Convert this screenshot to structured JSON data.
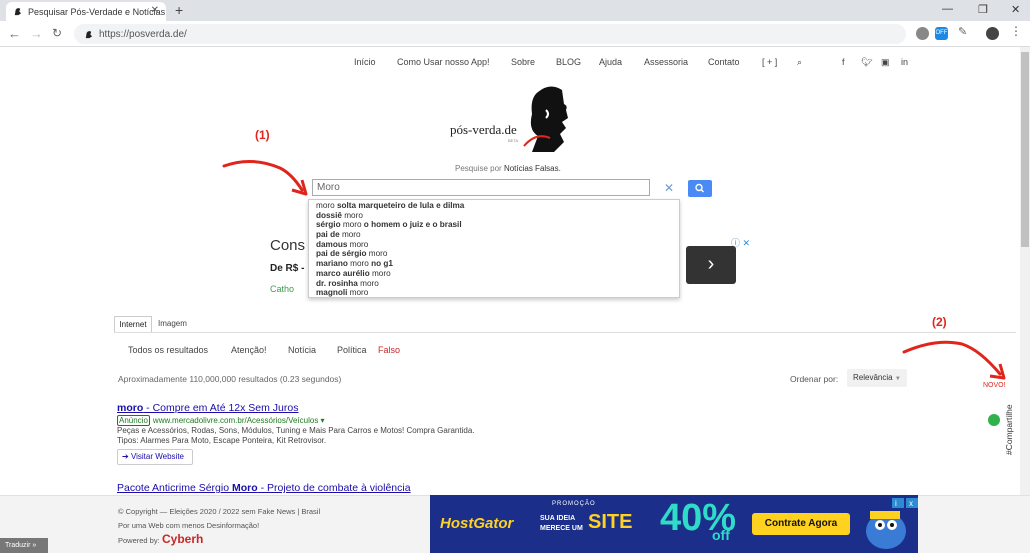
{
  "browser": {
    "tab_title": "Pesquisar Pós-Verdade e Notícias",
    "new_tab": "+",
    "window_min": "—",
    "window_restore": "❐",
    "window_close": "✕",
    "url": "https://posverda.de/",
    "ext_badge": "OFF"
  },
  "site_nav": {
    "items": [
      "Início",
      "Como Usar nosso App!",
      "Sobre",
      "BLOG",
      "Ajuda",
      "Assessoria",
      "Contato",
      "[ + ]"
    ],
    "social": [
      "f",
      "t",
      "ig",
      "in"
    ]
  },
  "logo": {
    "text": "pós-verda.de",
    "sub": "BETA"
  },
  "tagline": {
    "prefix": "Pesquise por",
    "bold": "Notícias Falsas."
  },
  "search": {
    "value": "Moro",
    "suggestions": [
      {
        "pre": "moro ",
        "bold": "solta marqueteiro de lula e dilma",
        "post": ""
      },
      {
        "pre": "",
        "bold": "dossiê ",
        "post": "moro"
      },
      {
        "pre": "",
        "bold": "sérgio ",
        "post": "moro ",
        "bold2": "o homem o juiz e o brasil"
      },
      {
        "pre": "",
        "bold": "pai de ",
        "post": "moro"
      },
      {
        "pre": "",
        "bold": "damous ",
        "post": "moro"
      },
      {
        "pre": "",
        "bold": "pai de sérgio ",
        "post": "moro"
      },
      {
        "pre": "",
        "bold": "mariano ",
        "post": "moro ",
        "bold2": "no g1"
      },
      {
        "pre": "",
        "bold": "marco aurélio ",
        "post": "moro"
      },
      {
        "pre": "",
        "bold": "dr. rosinha ",
        "post": "moro"
      },
      {
        "pre": "",
        "bold": "magnoli ",
        "post": "moro"
      }
    ]
  },
  "ad_behind": {
    "title": "Cons",
    "price": "De R$ -",
    "source": "Catho",
    "info": "ⓘ ✕"
  },
  "annotations": {
    "one": "(1)",
    "two": "(2)",
    "novo": "NOVO!",
    "compartilhe": "#Compartilhe"
  },
  "results_tabs": {
    "internet": "Internet",
    "imagem": "Imagem"
  },
  "filters": [
    "Todos os resultados",
    "Atenção!",
    "Notícia",
    "Política",
    "Falso"
  ],
  "result_count": "Aproximadamente 110,000,000 resultados (0.23 segundos)",
  "order": {
    "label": "Ordenar por:",
    "value": "Relevância"
  },
  "results": [
    {
      "title_bold": "moro",
      "title_rest": " - Compre em Até 12x Sem Juros",
      "ad_tag": "Anúncio",
      "url": "www.mercadolivre.com.br/Acessórios/Veículos ▾",
      "desc1": "Peças e Acessórios, Rodas, Sons, Módulos, Tuning e Mais Para Carros e Motos! Compra Garantida.",
      "desc2": "Tipos: Alarmes Para Moto, Escape Ponteira, Kit Retrovisor.",
      "visit": "Visitar Website"
    },
    {
      "title_pre": "Pacote Anticrime Sérgio ",
      "title_bold": "Moro",
      "title_rest": " - Projeto de combate à violência"
    }
  ],
  "footer": {
    "line1": "© Copyright — Eleições 2020 / 2022 sem Fake News | Brasil",
    "line2": "Por uma Web com menos Desinformação!",
    "powered": "Powered by:",
    "brand": "Cyberh",
    "translate": "Traduzir »"
  },
  "hostgator_ad": {
    "brand": "HostGator",
    "promo_label": "PROMOÇÃO",
    "promo_line1": "SUA IDEIA",
    "promo_line2": "MERECE UM",
    "promo_big": "SITE",
    "percent": "40%",
    "off": "off",
    "cta": "Contrate Agora"
  },
  "colors": {
    "accent_red": "#e0251c",
    "link": "#1a0dab",
    "search_btn": "#4a8af4",
    "hg_bg": "#1b2f8a"
  }
}
